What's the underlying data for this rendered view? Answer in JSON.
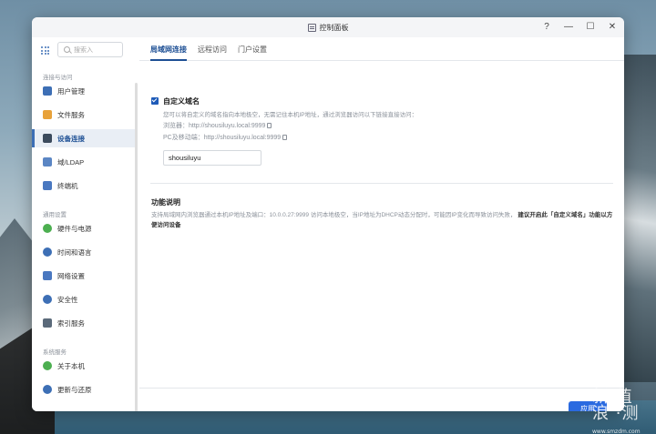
{
  "window": {
    "title": "控制面板",
    "controls": {
      "help": "?",
      "minimize": "—",
      "maximize": "☐",
      "close": "✕"
    }
  },
  "sidebar": {
    "search_placeholder": "搜索入",
    "sections": [
      {
        "title": "连接与访问",
        "items": [
          {
            "label": "用户管理",
            "icon": "user-icon",
            "color": "#3d6fb5"
          },
          {
            "label": "文件服务",
            "icon": "folder-icon",
            "color": "#e8a23a"
          },
          {
            "label": "设备连接",
            "icon": "device-icon",
            "color": "#3b4a5c",
            "active": true
          },
          {
            "label": "域/LDAP",
            "icon": "domain-icon",
            "color": "#5b86c4"
          },
          {
            "label": "终端机",
            "icon": "terminal-icon",
            "color": "#4a78c0"
          }
        ]
      },
      {
        "title": "通用设置",
        "items": [
          {
            "label": "硬件与电源",
            "icon": "power-icon",
            "color": "#4caf50"
          },
          {
            "label": "时间和语言",
            "icon": "clock-icon",
            "color": "#3d6fb5"
          },
          {
            "label": "网络设置",
            "icon": "network-icon",
            "color": "#4a78c0"
          },
          {
            "label": "安全性",
            "icon": "shield-icon",
            "color": "#3d6fb5"
          },
          {
            "label": "索引服务",
            "icon": "index-icon",
            "color": "#5b6a7a"
          }
        ]
      },
      {
        "title": "系统服务",
        "items": [
          {
            "label": "关于本机",
            "icon": "info-icon",
            "color": "#4caf50"
          },
          {
            "label": "更新与还原",
            "icon": "update-icon",
            "color": "#3d6fb5"
          }
        ]
      }
    ]
  },
  "tabs": [
    {
      "label": "局域网连接",
      "active": true
    },
    {
      "label": "远程访问",
      "active": false
    },
    {
      "label": "门户设置",
      "active": false
    }
  ],
  "lan": {
    "checkbox_label": "自定义域名",
    "checked": true,
    "description": "您可以将自定义的域名指向本地极空，无需记住本机IP地址，通过浏览器访问以下链接直接访问：",
    "browser_line": "浏览器：http://shousiluyu.local:9999",
    "pc_line": "PC及移动端：http://shousiluyu.local:9999",
    "domain_value": "shousiluyu"
  },
  "function": {
    "title": "功能说明",
    "desc_plain": "支持局域网内浏览器通过本机IP地址及端口：10.0.0.27:9999 访问本地极空，当IP地址为DHCP动态分配时，可能因IP变化而导致访问失败，",
    "desc_bold": "建议开启此「自定义域名」功能以方便访问设备"
  },
  "footer": {
    "apply_label": "应用"
  },
  "watermark": {
    "line1": "新 值",
    "line2": "浪 ·测",
    "small": "www.smzdm.com"
  }
}
